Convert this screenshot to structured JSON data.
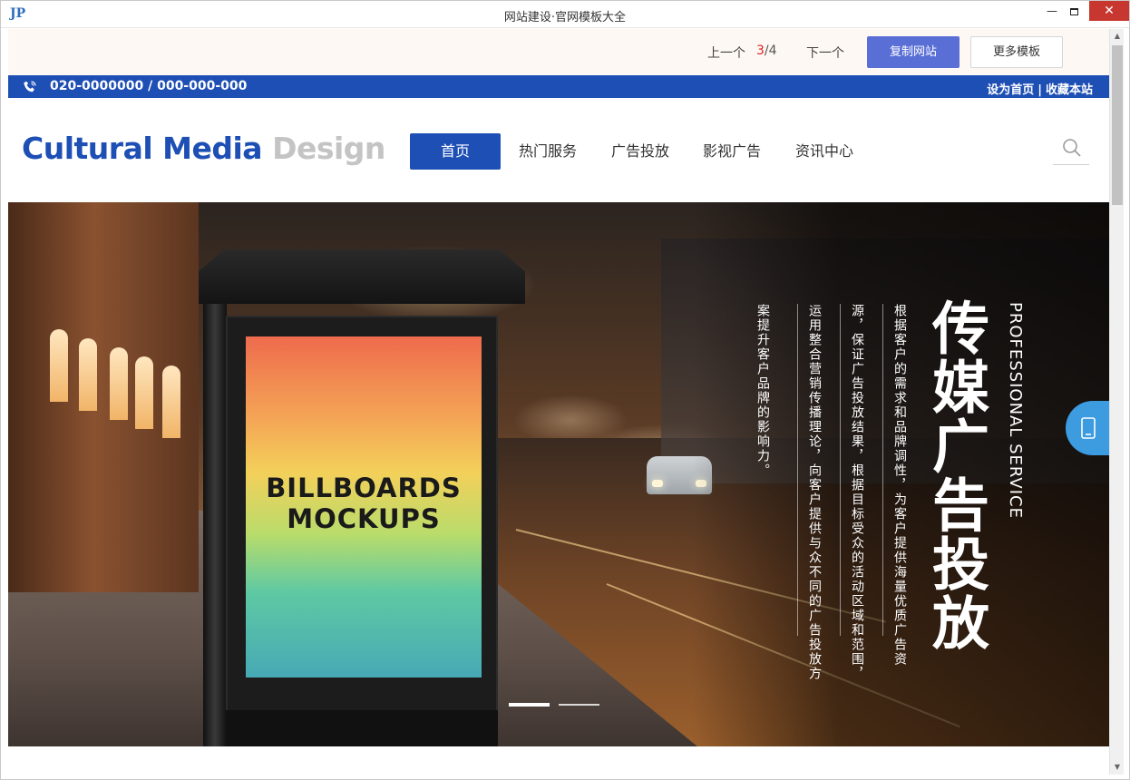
{
  "window": {
    "app_logo": "JP",
    "title": "网站建设·官网模板大全",
    "minimize": "—",
    "close": "✕"
  },
  "template_bar": {
    "prev": "上一个",
    "page_current": "3",
    "page_total": "/4",
    "next": "下一个",
    "copy_button": "复制网站",
    "more_button": "更多模板"
  },
  "info_bar": {
    "phone": "020-0000000 / 000-000-000",
    "set_home": "设为首页",
    "separator": "|",
    "bookmark": "收藏本站"
  },
  "header": {
    "logo_primary": "Cultural Media",
    "logo_secondary": "Design",
    "nav": [
      "首页",
      "热门服务",
      "广告投放",
      "影视广告",
      "资讯中心"
    ],
    "active_index": 0
  },
  "banner": {
    "billboard_line1": "BILLBOARDS",
    "billboard_line2": "MOCKUPS",
    "title": "传媒广告投放",
    "subtitle_en": "PROFESSIONAL SERVICE",
    "paragraph_cols": [
      "根据客户的需求和品牌调性，为客户提供海量优质广告资",
      "源，保证广告投放结果，根据目标受众的活动区域和范围，",
      "运用整合营销传播理论，向客户提供与众不同的广告投放方",
      "案提升客户品牌的影响力。"
    ],
    "slides_total": 2,
    "slide_active": 0
  },
  "colors": {
    "brand_blue": "#1e4fb5",
    "copy_button": "#5a6fd6",
    "float_button": "#3d9be0"
  }
}
